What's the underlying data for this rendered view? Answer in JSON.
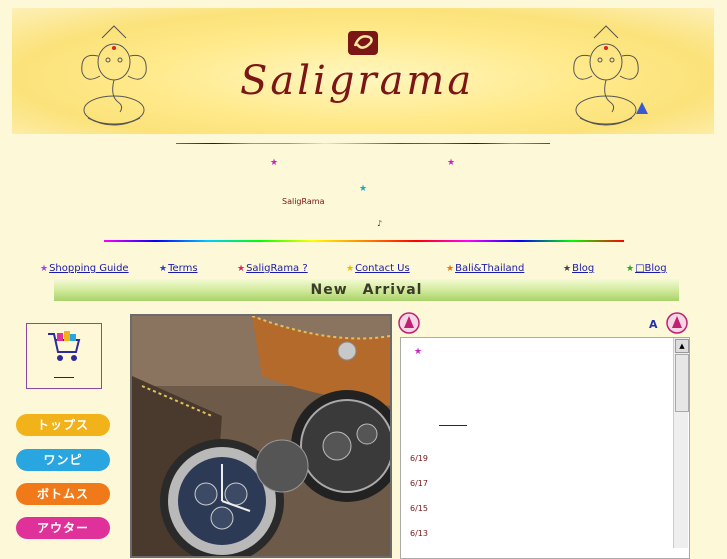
{
  "header": {
    "logo_text": "Saligrama"
  },
  "intro": {
    "brand": "SaligRama",
    "note": "♪"
  },
  "nav": {
    "items": [
      {
        "label": "Shopping Guide",
        "star_color": "#aa44dd"
      },
      {
        "label": "Terms",
        "star_color": "#2244cc"
      },
      {
        "label": "SaligRama ?",
        "star_color": "#dd2266"
      },
      {
        "label": "Contact Us",
        "star_color": "#eebb00"
      },
      {
        "label": "Bali&Thailand",
        "star_color": "#ee7700"
      },
      {
        "label": "Blog",
        "star_color": "#444444"
      },
      {
        "label": "Blog",
        "star_color": "#22aa22"
      }
    ],
    "blog_glyph": "□"
  },
  "section": {
    "title": "New　Arrival"
  },
  "sidebar": {
    "categories": [
      {
        "label": "トップス",
        "color": "#f2b21a"
      },
      {
        "label": "ワンピ",
        "color": "#29a6df"
      },
      {
        "label": "ボトムス",
        "color": "#f07a1a"
      },
      {
        "label": "アウター",
        "color": "#e0309a"
      }
    ]
  },
  "news": {
    "corner_letter": "A",
    "dates": [
      "6/19",
      "6/17",
      "6/15",
      "6/13"
    ]
  }
}
